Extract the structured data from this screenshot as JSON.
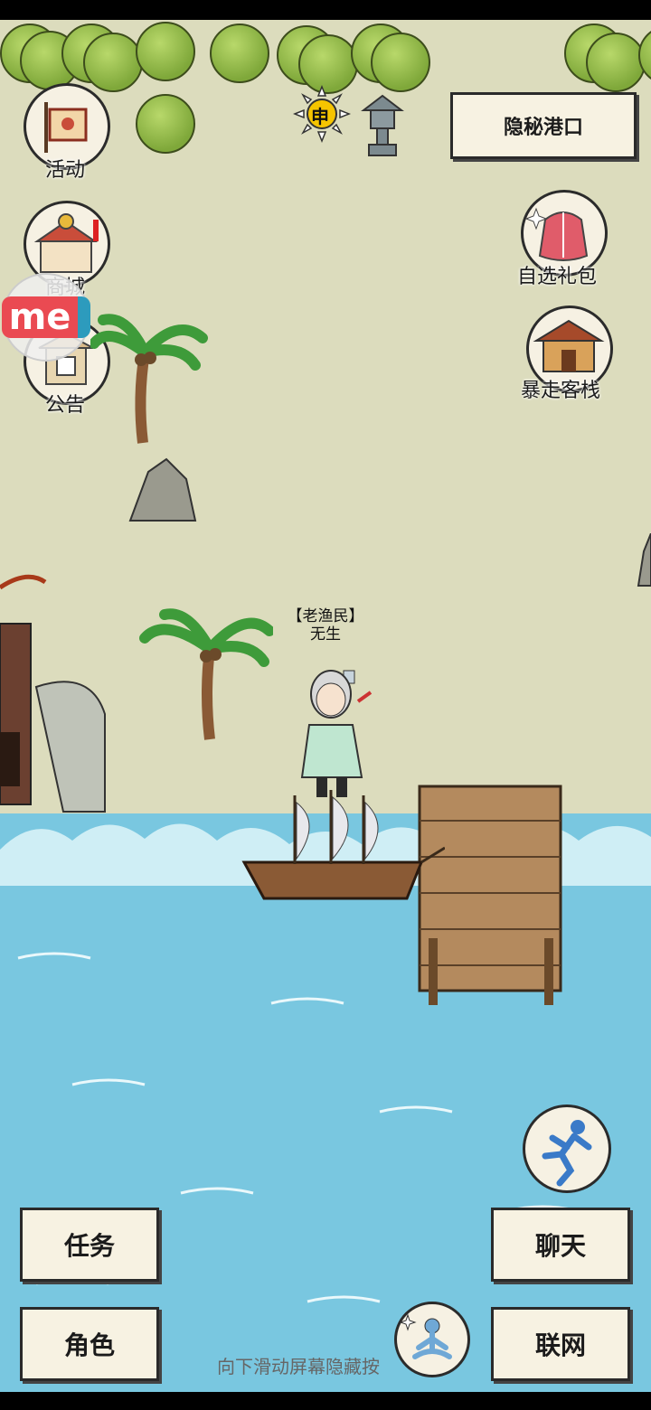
{
  "time_badge": "申",
  "location_label": "隐秘港口",
  "left_menu": [
    {
      "label": "活动",
      "icon": "flag-icon"
    },
    {
      "label": "商城",
      "icon": "shop-icon"
    },
    {
      "label": "公告",
      "icon": "notice-board-icon"
    }
  ],
  "right_menu": [
    {
      "label": "自选礼包",
      "icon": "gift-bag-icon"
    },
    {
      "label": "暴走客栈",
      "icon": "inn-icon"
    }
  ],
  "overlay_logo": "me",
  "npc": {
    "title": "【老渔民】",
    "name": "无生"
  },
  "bottom_left": {
    "task": "任务",
    "role": "角色"
  },
  "bottom_right": {
    "chat": "聊天",
    "network": "联网"
  },
  "hint_text": "向下滑动屏幕隐藏按",
  "colors": {
    "land": "#dcdcbd",
    "sea": "#79c7e0",
    "button_bg": "#f7f2e2"
  }
}
